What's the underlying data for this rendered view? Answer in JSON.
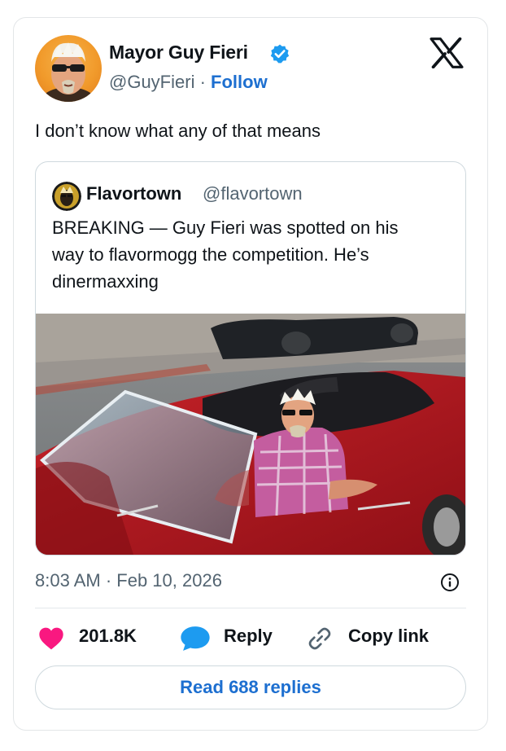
{
  "author": {
    "name": "Mayor Guy Fieri",
    "handle": "@GuyFieri",
    "separator": "·",
    "follow_label": "Follow",
    "verified": true
  },
  "platform_icon": "x-logo-icon",
  "tweet": {
    "text": "I don’t know what any of that means",
    "timestamp": "8:03 AM · Feb 10, 2026"
  },
  "quoted": {
    "name": "Flavortown",
    "handle": "@flavortown",
    "text_lines": [
      "BREAKING — Guy Fieri was spotted on his",
      "way to flavormogg the competition. He’s",
      "dinermaxxing"
    ]
  },
  "actions": {
    "likes": "201.8K",
    "reply_label": "Reply",
    "copy_label": "Copy link",
    "read_replies_label": "Read 688 replies"
  },
  "colors": {
    "link_blue": "#1d6fd0",
    "heart_pink": "#f91880",
    "reply_blue": "#1d9bf0",
    "muted_text": "#536471"
  }
}
